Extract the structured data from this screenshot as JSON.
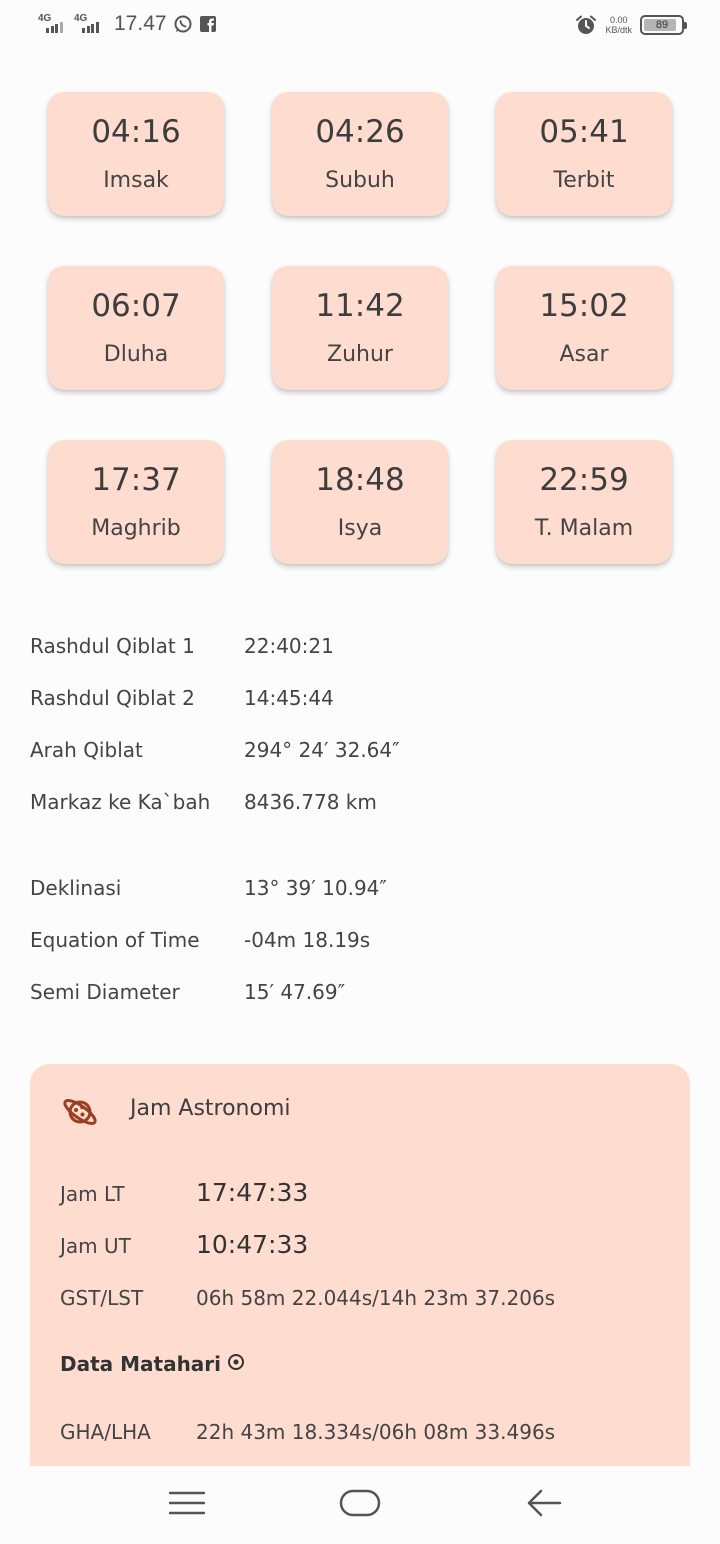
{
  "status_bar": {
    "network_1": "4G",
    "network_2": "4G",
    "time": "17.47",
    "netspeed_value": "0.00",
    "netspeed_unit": "KB/dtk",
    "battery": "89",
    "battery_level": 0.89
  },
  "prayer_times": [
    {
      "time": "04:16",
      "name": "Imsak"
    },
    {
      "time": "04:26",
      "name": "Subuh"
    },
    {
      "time": "05:41",
      "name": "Terbit"
    },
    {
      "time": "06:07",
      "name": "Dluha"
    },
    {
      "time": "11:42",
      "name": "Zuhur"
    },
    {
      "time": "15:02",
      "name": "Asar"
    },
    {
      "time": "17:37",
      "name": "Maghrib"
    },
    {
      "time": "18:48",
      "name": "Isya"
    },
    {
      "time": "22:59",
      "name": "T. Malam"
    }
  ],
  "qiblat": [
    {
      "label": "Rashdul Qiblat 1",
      "value": "22:40:21"
    },
    {
      "label": "Rashdul Qiblat 2",
      "value": "14:45:44"
    },
    {
      "label": "Arah Qiblat",
      "value": "294° 24′ 32.64″"
    },
    {
      "label": "Markaz ke Ka`bah",
      "value": "8436.778 km"
    }
  ],
  "sun_params": [
    {
      "label": "Deklinasi",
      "value": "13° 39′ 10.94″"
    },
    {
      "label": "Equation of Time",
      "value": "-04m 18.19s"
    },
    {
      "label": "Semi Diameter",
      "value": "15′ 47.69″"
    }
  ],
  "astronomy": {
    "title": "Jam Astronomi",
    "rows": [
      {
        "label": "Jam LT",
        "value": "17:47:33"
      },
      {
        "label": "Jam UT",
        "value": "10:47:33"
      },
      {
        "label": "GST/LST",
        "value": "06h 58m 22.044s/14h 23m 37.206s"
      }
    ],
    "sun_section": "Data Matahari",
    "sun_rows": [
      {
        "label": "GHA/LHA",
        "value": "22h 43m 18.334s/06h 08m 33.496s"
      }
    ]
  },
  "icons": {
    "whatsapp": "whatsapp-icon",
    "facebook": "facebook-icon",
    "alarm": "alarm-icon",
    "planet": "planet-icon",
    "sun": "sun-icon",
    "menu": "menu-icon",
    "home": "home-icon",
    "back": "back-icon"
  },
  "colors": {
    "card_bg": "#fedcd0",
    "planet_icon": "#9c3e1f"
  }
}
